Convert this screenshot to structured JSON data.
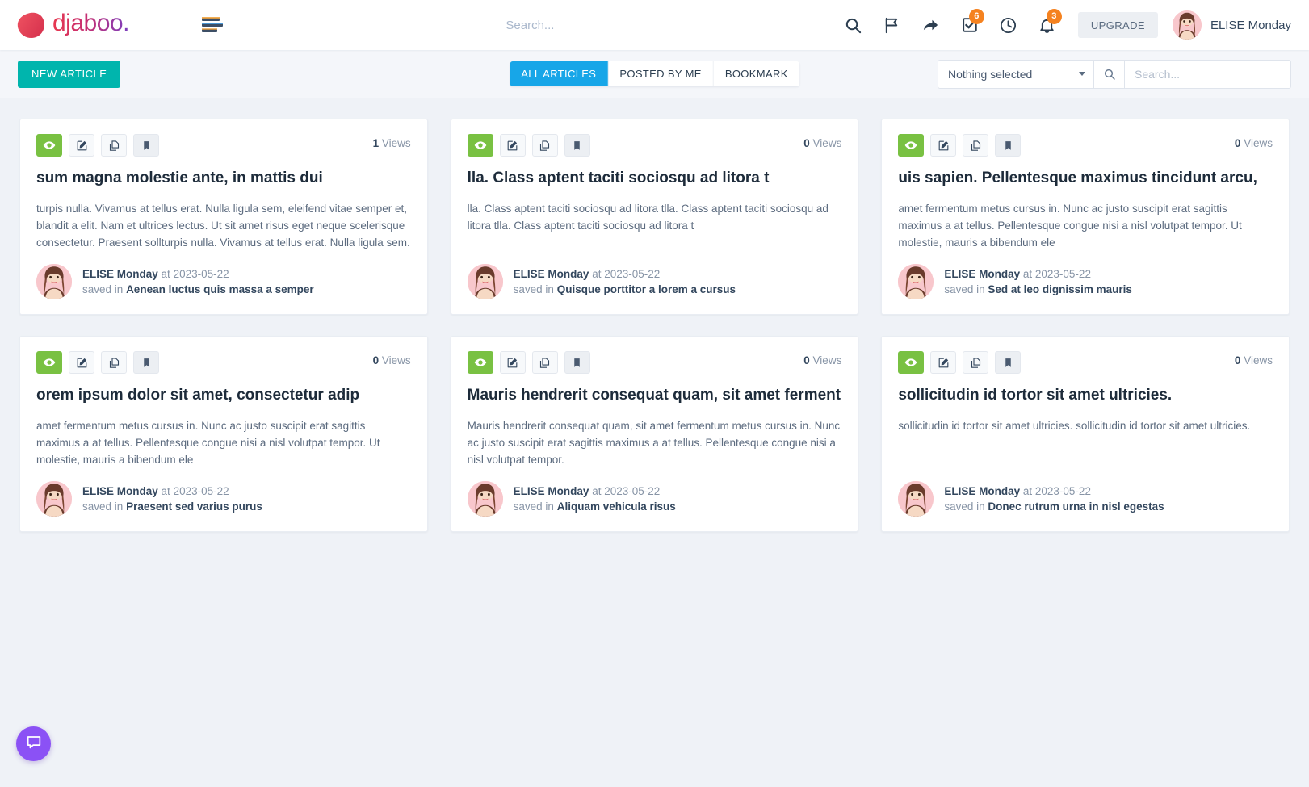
{
  "brand": {
    "name": "djaboo",
    "colors": {
      "start": "#e8384f",
      "end": "#7b3fbf"
    }
  },
  "header": {
    "menu_icon": "stacked-bars-icon",
    "search_placeholder": "Search...",
    "search_value": "",
    "icons": [
      {
        "name": "search-icon",
        "badge": null
      },
      {
        "name": "flag-icon",
        "badge": null
      },
      {
        "name": "share-arrow-icon",
        "badge": null
      },
      {
        "name": "checkbox-tasks-icon",
        "badge": "6"
      },
      {
        "name": "clock-icon",
        "badge": null
      },
      {
        "name": "bell-icon",
        "badge": "3"
      }
    ],
    "upgrade_label": "UPGRADE",
    "user_name": "ELISE Monday",
    "badge_color": "#f5821f"
  },
  "subbar": {
    "new_article_label": "NEW ARTICLE",
    "new_article_color": "#00b5ad",
    "tabs": [
      {
        "label": "ALL ARTICLES",
        "active": true
      },
      {
        "label": "POSTED BY ME",
        "active": false
      },
      {
        "label": "BOOKMARK",
        "active": false
      }
    ],
    "active_tab_color": "#17a6e8",
    "select_label": "Nothing selected",
    "search_placeholder": "Search...",
    "search_value": ""
  },
  "card_actions": [
    {
      "name": "view-button",
      "icon": "eye-icon",
      "active": true
    },
    {
      "name": "edit-button",
      "icon": "pencil-square-icon",
      "active": false
    },
    {
      "name": "duplicate-button",
      "icon": "copy-icon",
      "active": false
    },
    {
      "name": "bookmark-button",
      "icon": "bookmark-icon",
      "active": false
    }
  ],
  "labels": {
    "views_suffix": "Views",
    "at": "at",
    "saved_in": "saved in"
  },
  "articles": [
    {
      "views": "1",
      "title": "sum magna molestie ante, in mattis dui",
      "excerpt": "turpis nulla. Vivamus at tellus erat. Nulla ligula sem, eleifend vitae semper et, blandit a elit. Nam et ultrices lectus. Ut sit amet risus eget neque scelerisque consectetur. Praesent sollturpis nulla. Vivamus at tellus erat. Nulla ligula sem.",
      "author": "ELISE Monday",
      "date": "2023-05-22",
      "folder": "Aenean luctus quis massa a semper"
    },
    {
      "views": "0",
      "title": "lla. Class aptent taciti sociosqu ad litora t",
      "excerpt": "lla. Class aptent taciti sociosqu ad litora tlla. Class aptent taciti sociosqu ad litora tlla. Class aptent taciti sociosqu ad litora t",
      "author": "ELISE Monday",
      "date": "2023-05-22",
      "folder": "Quisque porttitor a lorem a cursus"
    },
    {
      "views": "0",
      "title": "uis sapien. Pellentesque maximus tincidunt arcu,",
      "excerpt": "amet fermentum metus cursus in. Nunc ac justo suscipit erat sagittis maximus a at tellus. Pellentesque congue nisi a nisl volutpat tempor. Ut molestie, mauris a bibendum ele",
      "author": "ELISE Monday",
      "date": "2023-05-22",
      "folder": "Sed at leo dignissim mauris"
    },
    {
      "views": "0",
      "title": "orem ipsum dolor sit amet, consectetur adip",
      "excerpt": "amet fermentum metus cursus in. Nunc ac justo suscipit erat sagittis maximus a at tellus. Pellentesque congue nisi a nisl volutpat tempor. Ut molestie, mauris a bibendum ele",
      "author": "ELISE Monday",
      "date": "2023-05-22",
      "folder": "Praesent sed varius purus"
    },
    {
      "views": "0",
      "title": "Mauris hendrerit consequat quam, sit amet fermentum",
      "excerpt": "Mauris hendrerit consequat quam, sit amet fermentum metus cursus in. Nunc ac justo suscipit erat sagittis maximus a at tellus. Pellentesque congue nisi a nisl volutpat tempor.",
      "author": "ELISE Monday",
      "date": "2023-05-22",
      "folder": "Aliquam vehicula risus"
    },
    {
      "views": "0",
      "title": "sollicitudin id tortor sit amet ultricies.",
      "excerpt": "sollicitudin id tortor sit amet ultricies. sollicitudin id tortor sit amet ultricies.",
      "author": "ELISE Monday",
      "date": "2023-05-22",
      "folder": "Donec rutrum urna in nisl egestas"
    }
  ],
  "chat": {
    "icon": "chat-bubble-icon",
    "color": "#8b51f5"
  }
}
